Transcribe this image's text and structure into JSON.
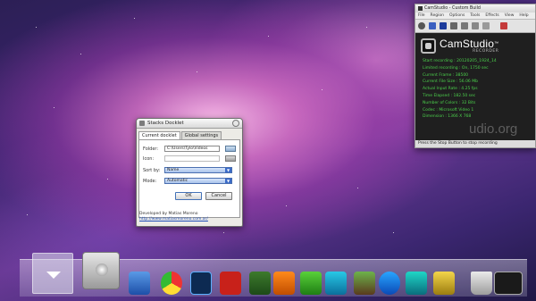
{
  "dialog": {
    "title": "Stacks Docklet",
    "tabs": [
      "Current docklet",
      "Global settings"
    ],
    "folder_label": "Folder:",
    "folder_value": "C:\\Users\\Tylo\\Videos",
    "icon_label": "Icon:",
    "sortby_label": "Sort by:",
    "sortby_value": "Name",
    "mode_label": "Mode:",
    "mode_value": "Automatic",
    "ok_label": "OK",
    "cancel_label": "Cancel",
    "developer_text": "Developed by Matias Moreno",
    "developer_link": "http://www.matiasmoreno.com.ar/"
  },
  "camstudio": {
    "title": "CamStudio - Custom Build",
    "menu": [
      "File",
      "Region",
      "Options",
      "Tools",
      "Effects",
      "View",
      "Help"
    ],
    "logo_name": "CamStudio",
    "logo_tm": "™",
    "logo_sub": "RECORDER",
    "stats": [
      "Start recording : 20120205_1924_14",
      "Limited recording : On, 1750 sec",
      "Current Frame : 38500",
      "Current File Size : 56.06 Mb",
      "Actual Input Rate : 4.25 fps",
      "Time Elapsed : 182.50 sec",
      "Number of Colors : 32 Bits",
      "Codec : Microsoft Video 1",
      "Dimension : 1366 X 768"
    ],
    "status": "Press the Stop Button to stop recording",
    "watermark": "udio.org"
  },
  "dock": {
    "icons": [
      "downloads-stack-icon",
      "hard-drive-icon",
      "computer-icon",
      "chrome-icon",
      "photoshop-icon",
      "flash-icon",
      "dreamweaver-icon",
      "app-icon-orange",
      "app-icon-green",
      "app-icon-cyan",
      "minecraft-icon",
      "app-icon-blue",
      "app-icon-teal",
      "app-icon-yellow",
      "trash-icon",
      "desktop-icon"
    ],
    "colors": {
      "accent": "#4bd04b",
      "dock_bg": "#c8c8dc"
    }
  }
}
